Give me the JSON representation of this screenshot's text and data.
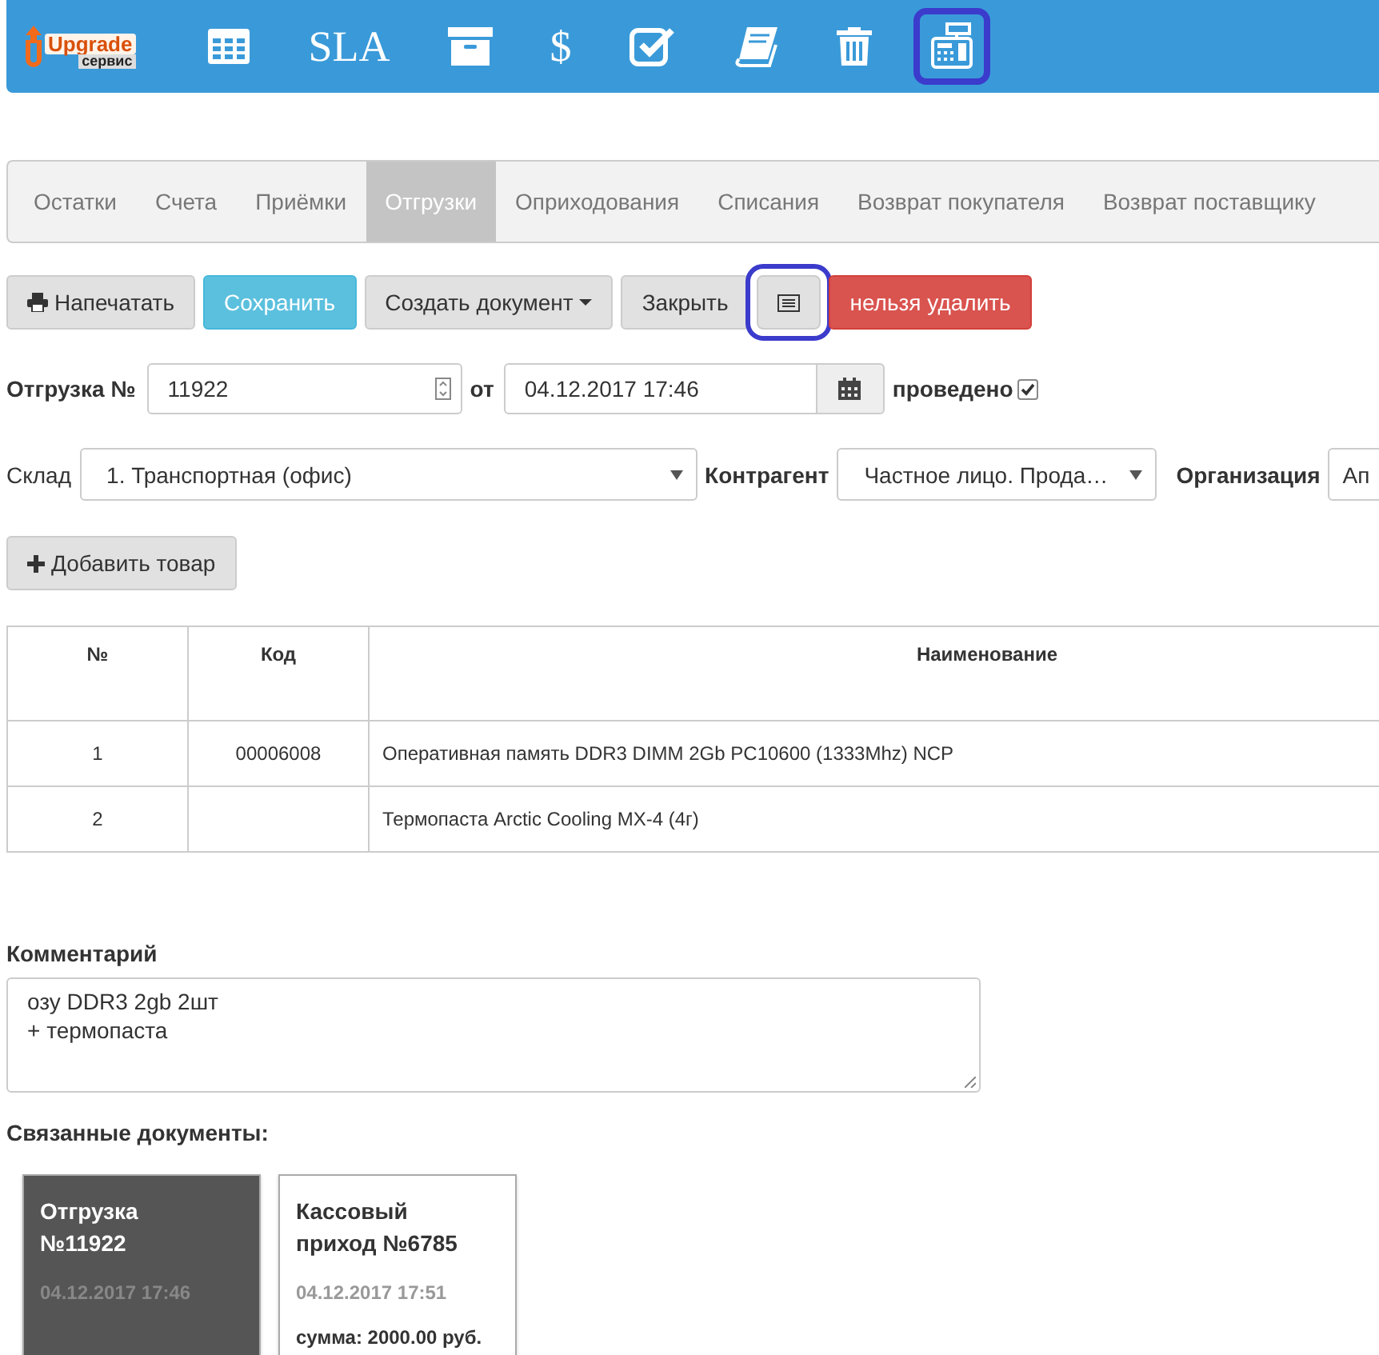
{
  "navbar": {
    "logo": {
      "name": "Upgrade",
      "tagline": "сервис"
    },
    "items": [
      {
        "kind": "grid",
        "highlighted": false
      },
      {
        "kind": "text",
        "label": "SLA",
        "highlighted": false
      },
      {
        "kind": "box",
        "highlighted": false
      },
      {
        "kind": "text",
        "label": "$",
        "highlighted": false
      },
      {
        "kind": "check",
        "highlighted": false
      },
      {
        "kind": "book",
        "highlighted": false
      },
      {
        "kind": "trash",
        "highlighted": false
      },
      {
        "kind": "register",
        "highlighted": true
      }
    ]
  },
  "tabs": [
    {
      "label": "Остатки",
      "selected": false
    },
    {
      "label": "Счета",
      "selected": false
    },
    {
      "label": "Приёмки",
      "selected": false
    },
    {
      "label": "Отгрузки",
      "selected": true
    },
    {
      "label": "Оприходования",
      "selected": false
    },
    {
      "label": "Списания",
      "selected": false
    },
    {
      "label": "Возврат покупателя",
      "selected": false
    },
    {
      "label": "Возврат поставщику",
      "selected": false
    }
  ],
  "toolbar": [
    {
      "kind": "print",
      "label": "Напечатать",
      "highlighted": false
    },
    {
      "kind": "primary",
      "label": "Сохранить",
      "highlighted": false
    },
    {
      "kind": "dropdown",
      "label": "Создать документ",
      "highlighted": false
    },
    {
      "kind": "plain",
      "label": "Закрыть",
      "highlighted": false
    },
    {
      "kind": "icon",
      "highlighted": true
    },
    {
      "kind": "danger",
      "label": "нельзя удалить",
      "highlighted": false
    }
  ],
  "document": {
    "label": "Отгрузка №",
    "number": "11922",
    "date_label": "от",
    "date": "04.12.2017 17:46",
    "posted_label": "проведено",
    "posted": true
  },
  "filters": [
    {
      "label": "Склад",
      "bold": false,
      "value": "1. Транспортная (офис)"
    },
    {
      "label": "Контрагент",
      "bold": true,
      "value": "Частное лицо. Прода…"
    },
    {
      "label": "Организация",
      "bold": true,
      "value": "Ап"
    }
  ],
  "add_button": "Добавить товар",
  "table": {
    "columns": [
      "№",
      "Код",
      "Наименование"
    ],
    "rows": [
      [
        "1",
        "00006008",
        "Оперативная память DDR3 DIMM 2Gb PC10600 (1333Mhz) NCP"
      ],
      [
        "2",
        "",
        "Термопаста Arctic Cooling MX-4 (4г)"
      ]
    ]
  },
  "comment": {
    "label": "Комментарий",
    "lines": [
      "озу DDR3 2gb 2шт",
      "+ термопаста"
    ]
  },
  "related": {
    "label": "Связанные документы:",
    "cards": [
      {
        "title": "Отгрузка №11922",
        "date": "04.12.2017 17:46",
        "selected": true
      },
      {
        "title": "Кассовый приход №6785",
        "date": "04.12.2017 17:51",
        "sum": "сумма: 2000.00 руб.",
        "selected": false
      }
    ]
  }
}
